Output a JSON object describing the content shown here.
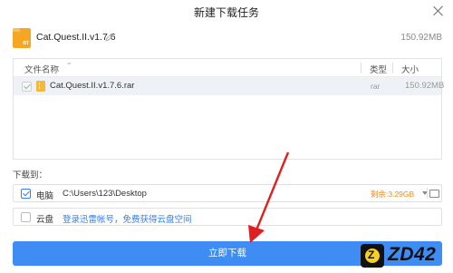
{
  "window": {
    "title": "新建下载任务"
  },
  "task": {
    "icon": "bt-file-icon",
    "icon_text": "BT",
    "name": "Cat.Quest.II.v1.7.6",
    "size": "150.92MB"
  },
  "file_list": {
    "columns": {
      "name": "文件名称",
      "type": "类型",
      "size": "大小"
    },
    "rows": [
      {
        "name": "Cat.Quest.II.v1.7.6.rar",
        "type": "rar",
        "size": "150.92MB",
        "checked": true
      }
    ]
  },
  "download_to": {
    "label": "下载到：",
    "pc": {
      "label": "电脑",
      "path": "C:\\Users\\123\\Desktop",
      "free": "剩余:3.29GB",
      "checked": true
    },
    "cloud": {
      "label": "云盘",
      "link": "登录迅雷帐号，免费获得云盘空间",
      "checked": false
    }
  },
  "primary_button": {
    "label": "立即下载"
  },
  "watermark": {
    "text": "ZD42",
    "logo": "Z"
  },
  "colors": {
    "accent": "#3f8cf5",
    "arrow": "#e02020",
    "free_space": "#f08a24"
  }
}
